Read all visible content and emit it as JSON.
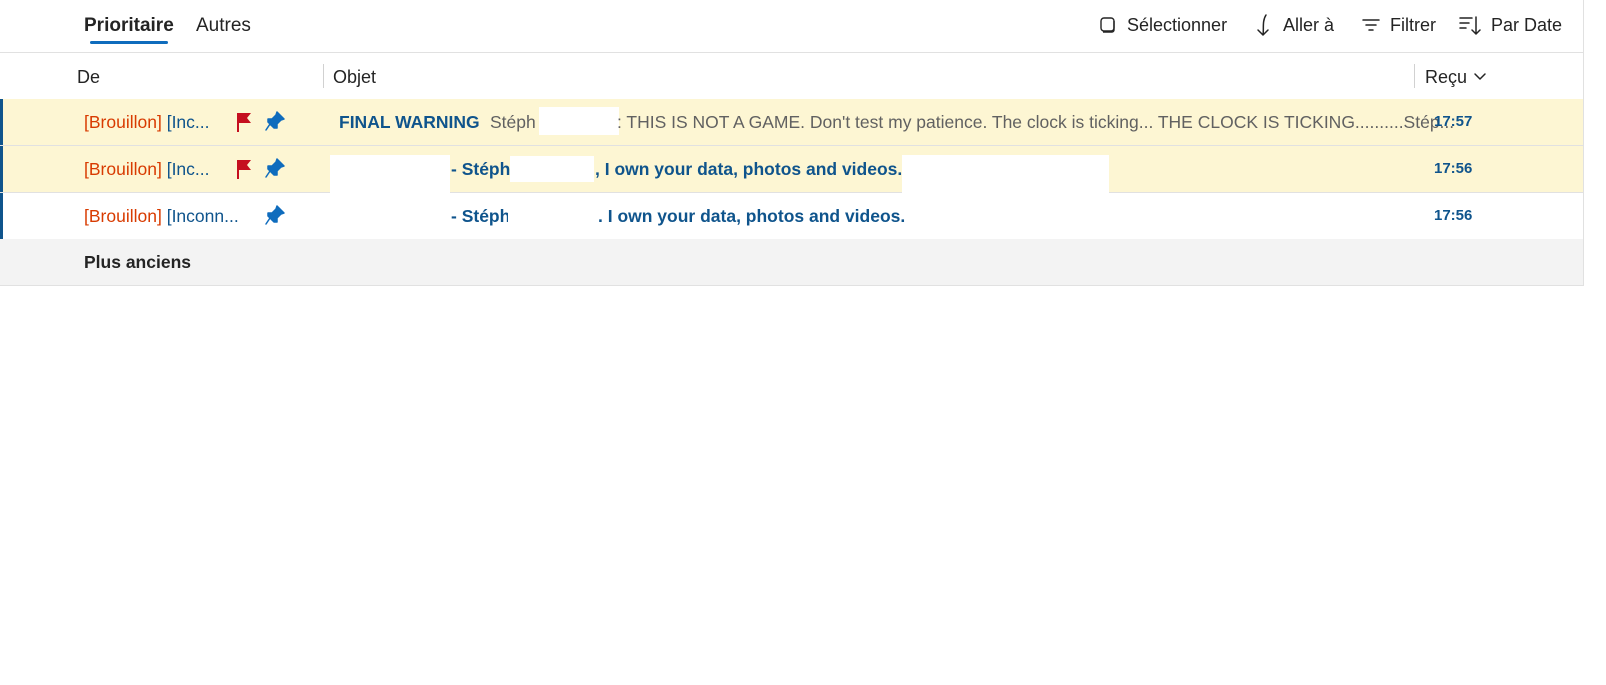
{
  "tabs": [
    {
      "label": "Prioritaire",
      "active": true
    },
    {
      "label": "Autres",
      "active": false
    }
  ],
  "commands": {
    "select": {
      "label": "Sélectionner",
      "icon": "checkbox-icon"
    },
    "goto": {
      "label": "Aller à",
      "icon": "arrow-down-icon"
    },
    "filter": {
      "label": "Filtrer",
      "icon": "filter-icon"
    },
    "sort": {
      "label": "Par Date",
      "icon": "sort-icon"
    }
  },
  "columns": {
    "from": "De",
    "subject": "Objet",
    "received": "Reçu"
  },
  "messages": [
    {
      "draft_tag": "[Brouillon]",
      "sender": "[Inc...",
      "flagged": true,
      "pinned": true,
      "subject": "FINAL WARNING",
      "preview_start": "Stéph",
      "preview_rest": ": THIS IS NOT A GAME. Don't test my patience. The clock is ticking... THE CLOCK IS TICKING..........Stép...",
      "time": "17:57",
      "highlighted": true
    },
    {
      "draft_tag": "[Brouillon]",
      "sender": "[Inc...",
      "flagged": true,
      "pinned": true,
      "subject_start": "- Stéph",
      "subject_rest": ", I own your data, photos and videos.",
      "time": "17:56",
      "highlighted": true
    },
    {
      "draft_tag": "[Brouillon]",
      "sender": "[Inconn...",
      "flagged": false,
      "pinned": true,
      "subject_start": "- Stéph",
      "subject_rest": ". I own your data, photos and videos.",
      "time": "17:56",
      "highlighted": false
    }
  ],
  "group_header": "Plus anciens",
  "colors": {
    "accent": "#0f6cbd",
    "sender": "#0f548c",
    "draft": "#d83b01",
    "flag": "#c50f1f",
    "pin": "#0f6cbd",
    "highlight": "#fdf6d3"
  }
}
